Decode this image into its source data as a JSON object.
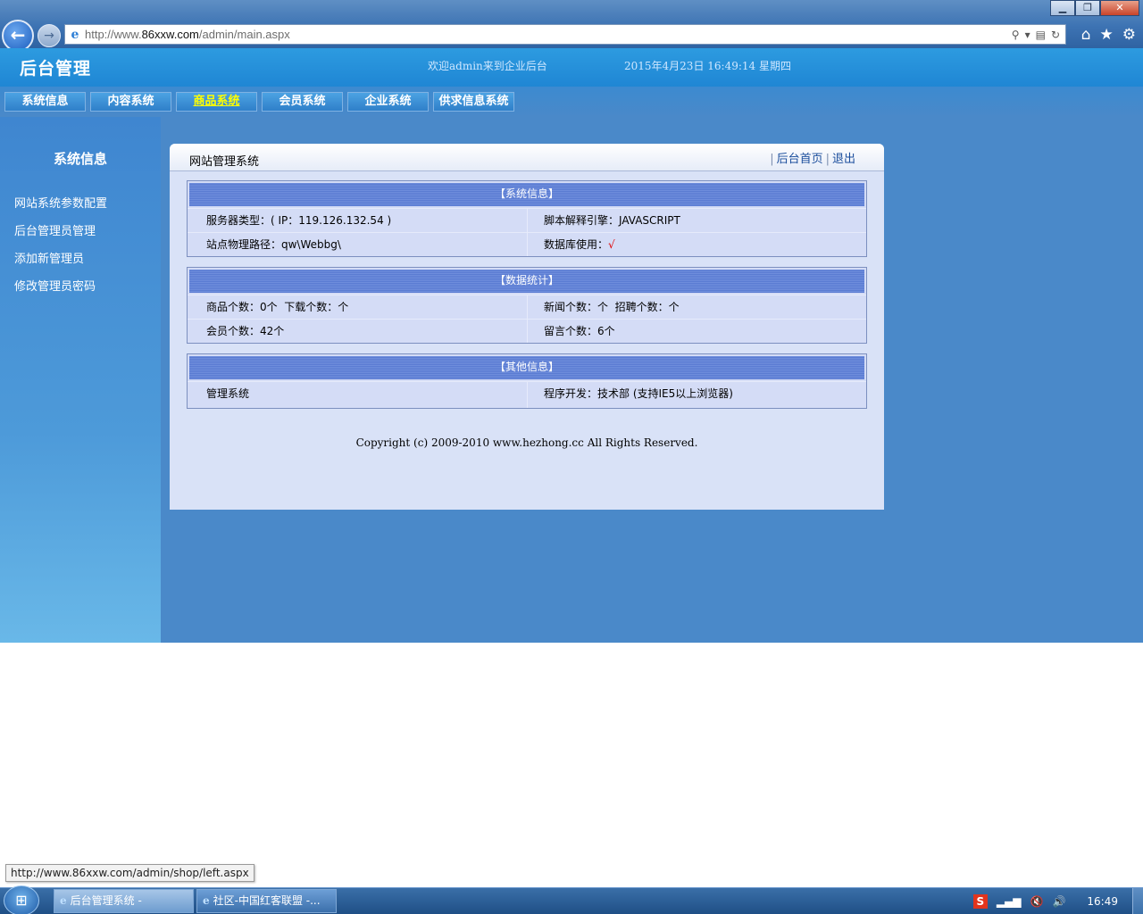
{
  "browser": {
    "url_prefix": "http://www.",
    "url_domain": "86xxw.com",
    "url_path": "/admin/main.aspx",
    "minimize": "▁",
    "restore": "❐",
    "close": "✕"
  },
  "header": {
    "brand": "后台管理",
    "welcome": "欢迎admin来到企业后台",
    "datetime": "2015年4月23日 16:49:14 星期四"
  },
  "menu": [
    {
      "label": "系统信息"
    },
    {
      "label": "内容系统"
    },
    {
      "label": "商品系统"
    },
    {
      "label": "会员系统"
    },
    {
      "label": "企业系统"
    },
    {
      "label": "供求信息系统"
    }
  ],
  "sidebar": {
    "title": "系统信息",
    "links": [
      "网站系统参数配置",
      "后台管理员管理",
      "添加新管理员",
      "修改管理员密码"
    ]
  },
  "panel": {
    "title": "网站管理系统",
    "home_link": "后台首页",
    "logout_link": "退出",
    "sep": "|"
  },
  "system_info": {
    "heading": "【系统信息】",
    "server_type": "服务器类型：( IP：119.126.132.54 )",
    "script_engine": "脚本解释引擎：JAVASCRIPT",
    "physical_path": "站点物理路径：qw\\Webbg\\",
    "db_label": "数据库使用：",
    "db_mark": "√"
  },
  "data_stats": {
    "heading": "【数据统计】",
    "goods_download": "商品个数：0个  下载个数：个",
    "news_jobs": "新闻个数：个  招聘个数：个",
    "members": "会员个数：42个",
    "messages": "留言个数：6个"
  },
  "other_info": {
    "heading": "【其他信息】",
    "system": "管理系统",
    "developer": "程序开发：技术部 (支持IE5以上浏览器)"
  },
  "copyright": "Copyright (c) 2009-2010 www.hezhong.cc All Rights Reserved.",
  "status_url": "http://www.86xxw.com/admin/shop/left.aspx",
  "taskbar": {
    "tasks": [
      "后台管理系统 -",
      "社区-中国红客联盟 -..."
    ],
    "clock": "16:49",
    "ime": "S"
  }
}
